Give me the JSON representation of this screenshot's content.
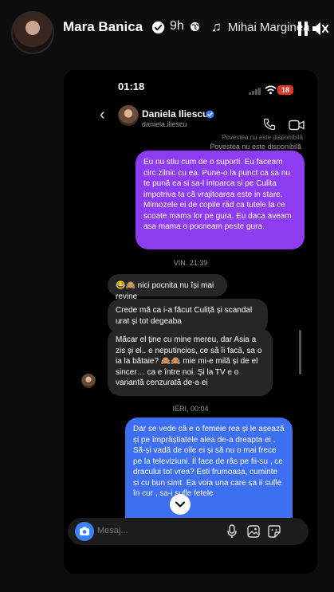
{
  "story": {
    "username": "Mara Banica",
    "time_ago": "9h",
    "music": "Mihai Margineanu"
  },
  "phone": {
    "status_time": "01:18",
    "battery": "18",
    "chat": {
      "name": "Daniela Iliescu",
      "handle": "daniela.iliescu",
      "unavailable_top": "Povestea nu este disponibilă",
      "unavailable": "Povestea nu este disponibilă"
    },
    "messages": {
      "purple": "Eu nu stiu cum de o suporti. Eu faceam circ zilnic cu ea. Pune-o la punct ca sa nu te pună ea si sa-l intoarca si pe Culita impotriva ta că vrajitoarea este in stare. Mimozele ei de copile răd ca tutele la ce scoate mama lor pe gura. Eu daca aveam asa mama o pocneam peste gura.",
      "date1": "VIN. 21:39",
      "gray1": "😂🙈 nici pocnita nu își mai revine",
      "gray2": "Crede mă ca i-a făcut Culiță și scandal urat și tot degeaba",
      "gray3": "Măcar el ține cu mine mereu, dar Asia a zis și el.. e neputincios, ce să îi facă, sa o ia la bătaie? 🙈🙈 mie mi-e milă și de el sincer… ca e între noi. Și la TV e o variantă cenzurată de-a ei",
      "date2": "IERI, 00:04",
      "blue": "Dar se vede că e o femeie rea  și le așează și pe împrăștiatele alea de-a dreapta ei . Să-și vadă de oile ei și să nu o mai frece pe la televiziuni. Îl face de râs pe fii-su , ce dracului tot vrea? Esti frumoasa, cuminte si cu bun simt. Ea voia una care sa ii sufle în cur , sa-i sufle fetele"
    },
    "composer": {
      "placeholder": "Mesaj..."
    }
  },
  "colors": {
    "sent_purple": "#8e3cf2",
    "sent_blue": "#3d6ff0",
    "received": "#262626",
    "verified": "#3b82f6"
  }
}
